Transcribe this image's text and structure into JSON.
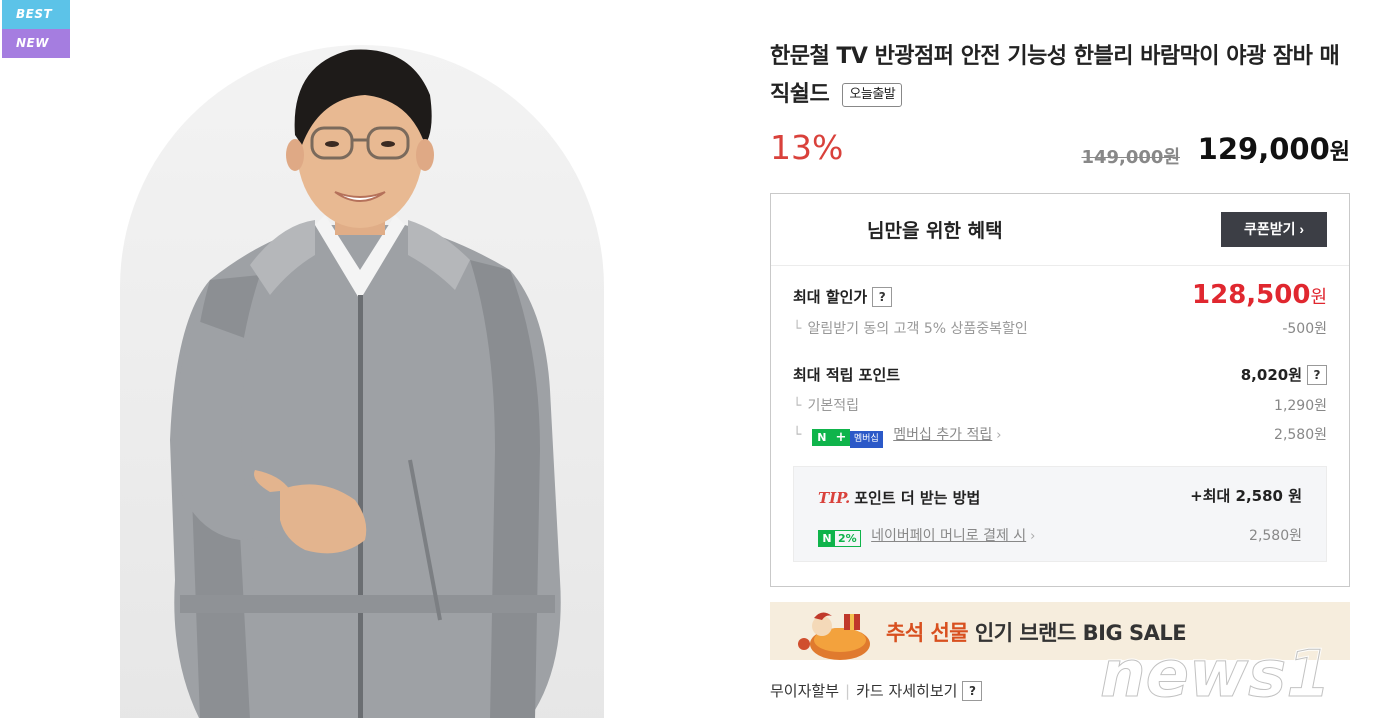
{
  "badges": {
    "best": "BEST",
    "new": "NEW"
  },
  "product": {
    "title": "한문철 TV 반광점퍼 안전 기능성 한블리 바람막이 야광 잠바 매직쉴드",
    "ship_tag": "오늘출발",
    "discount_rate": "13%",
    "original_price": "149,000원",
    "sale_price_number": "129,000",
    "sale_price_unit": "원"
  },
  "benefits": {
    "title": "님만을 위한 혜택",
    "coupon_button": "쿠폰받기 ›",
    "max_discount": {
      "label": "최대 할인가",
      "help": "?",
      "price_number": "128,500",
      "price_unit": "원",
      "sub_label": "알림받기 동의 고객 5% 상품중복할인",
      "sub_value": "-500원"
    },
    "max_points": {
      "label": "최대 적립 포인트",
      "value": "8,020원",
      "help": "?",
      "basic_label": "기본적립",
      "basic_value": "1,290원",
      "membership_badge_n": "N",
      "membership_badge_plus": "+",
      "membership_badge_text": "멤버십",
      "membership_label": "멤버십 추가 적립",
      "membership_value": "2,580원"
    },
    "tip": {
      "tip_word": "TIP.",
      "title": "포인트 더 받는 방법",
      "max": "+최대 2,580 원",
      "badge_n": "N",
      "badge_pct": "2%",
      "pay_label": "네이버페이 머니로 결제 시",
      "pay_value": "2,580원"
    }
  },
  "banner": {
    "highlight": "추석 선물",
    "text": " 인기 브랜드 BIG SALE"
  },
  "bottom_links": {
    "installment": "무이자할부",
    "card_detail": "카드 자세히보기",
    "help": "?"
  },
  "watermark": "news1",
  "colors": {
    "discount_red": "#d9413b",
    "max_price_red": "#e0272f",
    "coupon_btn": "#3c3e45",
    "naver_green": "#0fb44b",
    "badge_best": "#5cc3e8",
    "badge_new": "#a57de0"
  }
}
